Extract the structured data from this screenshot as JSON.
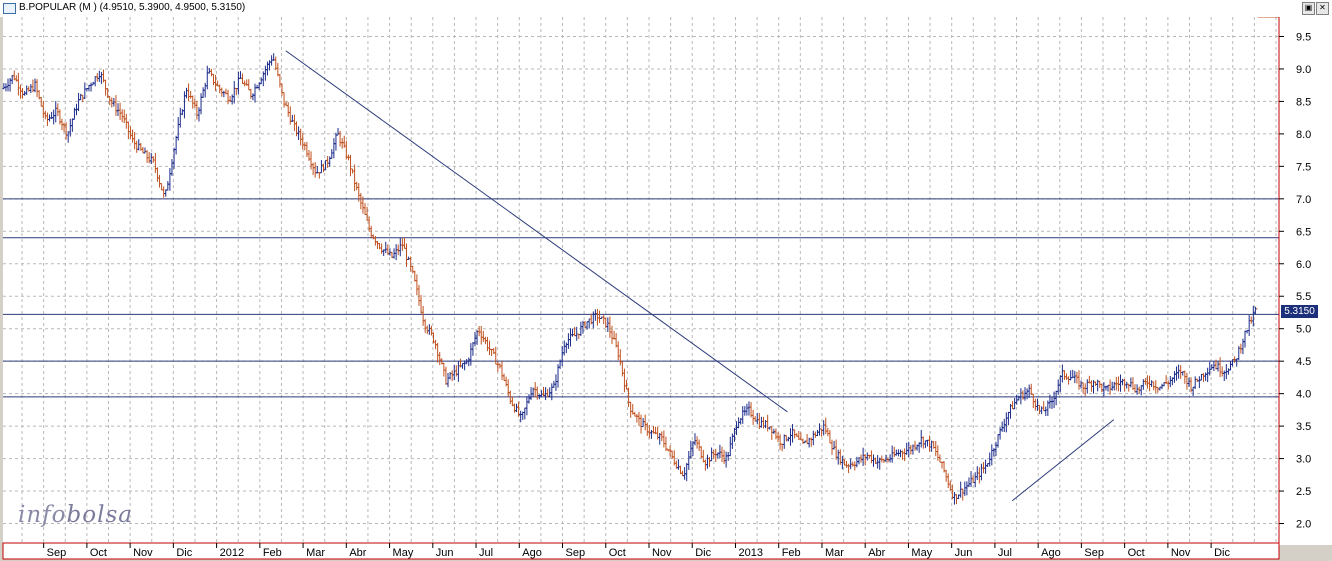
{
  "window": {
    "title": "B.POPULAR (M ) (4.9510, 5.3900, 4.9500, 5.3150)",
    "restore_icon": "restore-icon",
    "close_icon": "close-icon"
  },
  "watermark": {
    "part1": "info",
    "part2": "bolsa"
  },
  "colors": {
    "up": "#1a2a8a",
    "down": "#c0501e",
    "grid": "#b8b8b8",
    "hline": "#2b3a7a",
    "trend": "#2b3a7a",
    "frame": "#c00000"
  },
  "chart_data": {
    "type": "ohlc",
    "title": "B.POPULAR (M ) (4.9510, 5.3900, 4.9500, 5.3150)",
    "last_value_label": "5.3150",
    "y_ticks": [
      "2.0",
      "2.5",
      "3.0",
      "3.5",
      "4.0",
      "4.5",
      "5.0",
      "5.5",
      "6.0",
      "6.5",
      "7.0",
      "7.5",
      "8.0",
      "8.5",
      "9.0",
      "9.5"
    ],
    "ylim": [
      1.7,
      9.8
    ],
    "x_labels": [
      "Sep",
      "Oct",
      "Nov",
      "Dic",
      "2012",
      "Feb",
      "Mar",
      "Abr",
      "May",
      "Jun",
      "Jul",
      "Ago",
      "Sep",
      "Oct",
      "Nov",
      "Dic",
      "2013",
      "Feb",
      "Mar",
      "Abr",
      "May",
      "Jun",
      "Jul",
      "Ago",
      "Sep",
      "Oct",
      "Nov",
      "Dic"
    ],
    "x_label_positions_months": [
      1,
      2,
      3,
      4,
      5,
      6,
      7,
      8,
      9,
      10,
      11,
      12,
      13,
      14,
      15,
      16,
      17,
      18,
      19,
      20,
      21,
      22,
      23,
      24,
      25,
      26,
      27,
      28
    ],
    "xlim_months": [
      0.06,
      29.57
    ],
    "horizontal_levels": [
      7.0,
      6.4,
      5.22,
      4.5,
      3.95
    ],
    "trendlines": [
      {
        "x1": 6.6,
        "y1": 9.28,
        "x2": 18.2,
        "y2": 3.72
      },
      {
        "x1": 23.4,
        "y1": 2.35,
        "x2": 25.75,
        "y2": 3.6
      }
    ],
    "close_series": {
      "x": [
        0.06,
        0.3,
        0.55,
        0.8,
        1.05,
        1.3,
        1.55,
        1.8,
        2.05,
        2.3,
        2.55,
        2.8,
        3.05,
        3.3,
        3.55,
        3.8,
        4.05,
        4.3,
        4.55,
        4.8,
        5.05,
        5.3,
        5.55,
        5.8,
        6.05,
        6.3,
        6.55,
        6.8,
        7.05,
        7.3,
        7.55,
        7.8,
        8.05,
        8.3,
        8.55,
        8.8,
        9.05,
        9.3,
        9.55,
        9.8,
        10.05,
        10.3,
        10.55,
        10.8,
        11.05,
        11.3,
        11.55,
        11.8,
        12.05,
        12.3,
        12.55,
        12.8,
        13.05,
        13.3,
        13.55,
        13.8,
        14.05,
        14.3,
        14.55,
        14.8,
        15.05,
        15.3,
        15.55,
        15.8,
        16.05,
        16.3,
        16.55,
        16.8,
        17.05,
        17.3,
        17.55,
        17.8,
        18.05,
        18.3,
        18.55,
        18.8,
        19.05,
        19.3,
        19.55,
        19.8,
        20.05,
        20.3,
        20.55,
        20.8,
        21.05,
        21.3,
        21.55,
        21.8,
        22.05,
        22.3,
        22.55,
        22.8,
        23.05,
        23.3,
        23.55,
        23.8,
        24.05,
        24.3,
        24.55,
        24.8,
        25.05,
        25.3,
        25.55,
        25.8,
        26.05,
        26.3,
        26.55,
        26.8,
        27.05,
        27.3,
        27.55,
        27.8,
        28.05,
        28.3,
        28.55,
        28.8,
        29.05,
        29.3,
        29.57
      ],
      "y": [
        8.7,
        8.9,
        8.6,
        8.75,
        8.2,
        8.35,
        8.0,
        8.5,
        8.75,
        8.95,
        8.5,
        8.3,
        7.9,
        7.7,
        7.55,
        7.0,
        7.9,
        8.7,
        8.3,
        8.95,
        8.7,
        8.55,
        8.85,
        8.6,
        8.9,
        9.2,
        8.5,
        8.1,
        7.8,
        7.4,
        7.55,
        8.0,
        7.6,
        7.0,
        6.5,
        6.25,
        6.1,
        6.3,
        5.8,
        5.1,
        4.8,
        4.2,
        4.35,
        4.5,
        5.0,
        4.7,
        4.4,
        3.9,
        3.6,
        4.1,
        3.95,
        4.1,
        4.8,
        4.9,
        5.1,
        5.2,
        5.05,
        4.6,
        3.8,
        3.55,
        3.4,
        3.3,
        3.0,
        2.75,
        3.3,
        2.95,
        3.1,
        3.0,
        3.6,
        3.75,
        3.55,
        3.5,
        3.25,
        3.4,
        3.2,
        3.35,
        3.5,
        3.1,
        2.9,
        2.95,
        3.05,
        2.95,
        3.0,
        3.1,
        3.15,
        3.3,
        3.2,
        2.85,
        2.4,
        2.55,
        2.7,
        2.9,
        3.3,
        3.7,
        3.95,
        4.05,
        3.7,
        3.85,
        4.3,
        4.25,
        4.1,
        4.2,
        4.05,
        4.15,
        4.2,
        4.05,
        4.2,
        4.1,
        4.2,
        4.35,
        4.1,
        4.3,
        4.45,
        4.35,
        4.5,
        4.95,
        5.315
      ]
    }
  }
}
